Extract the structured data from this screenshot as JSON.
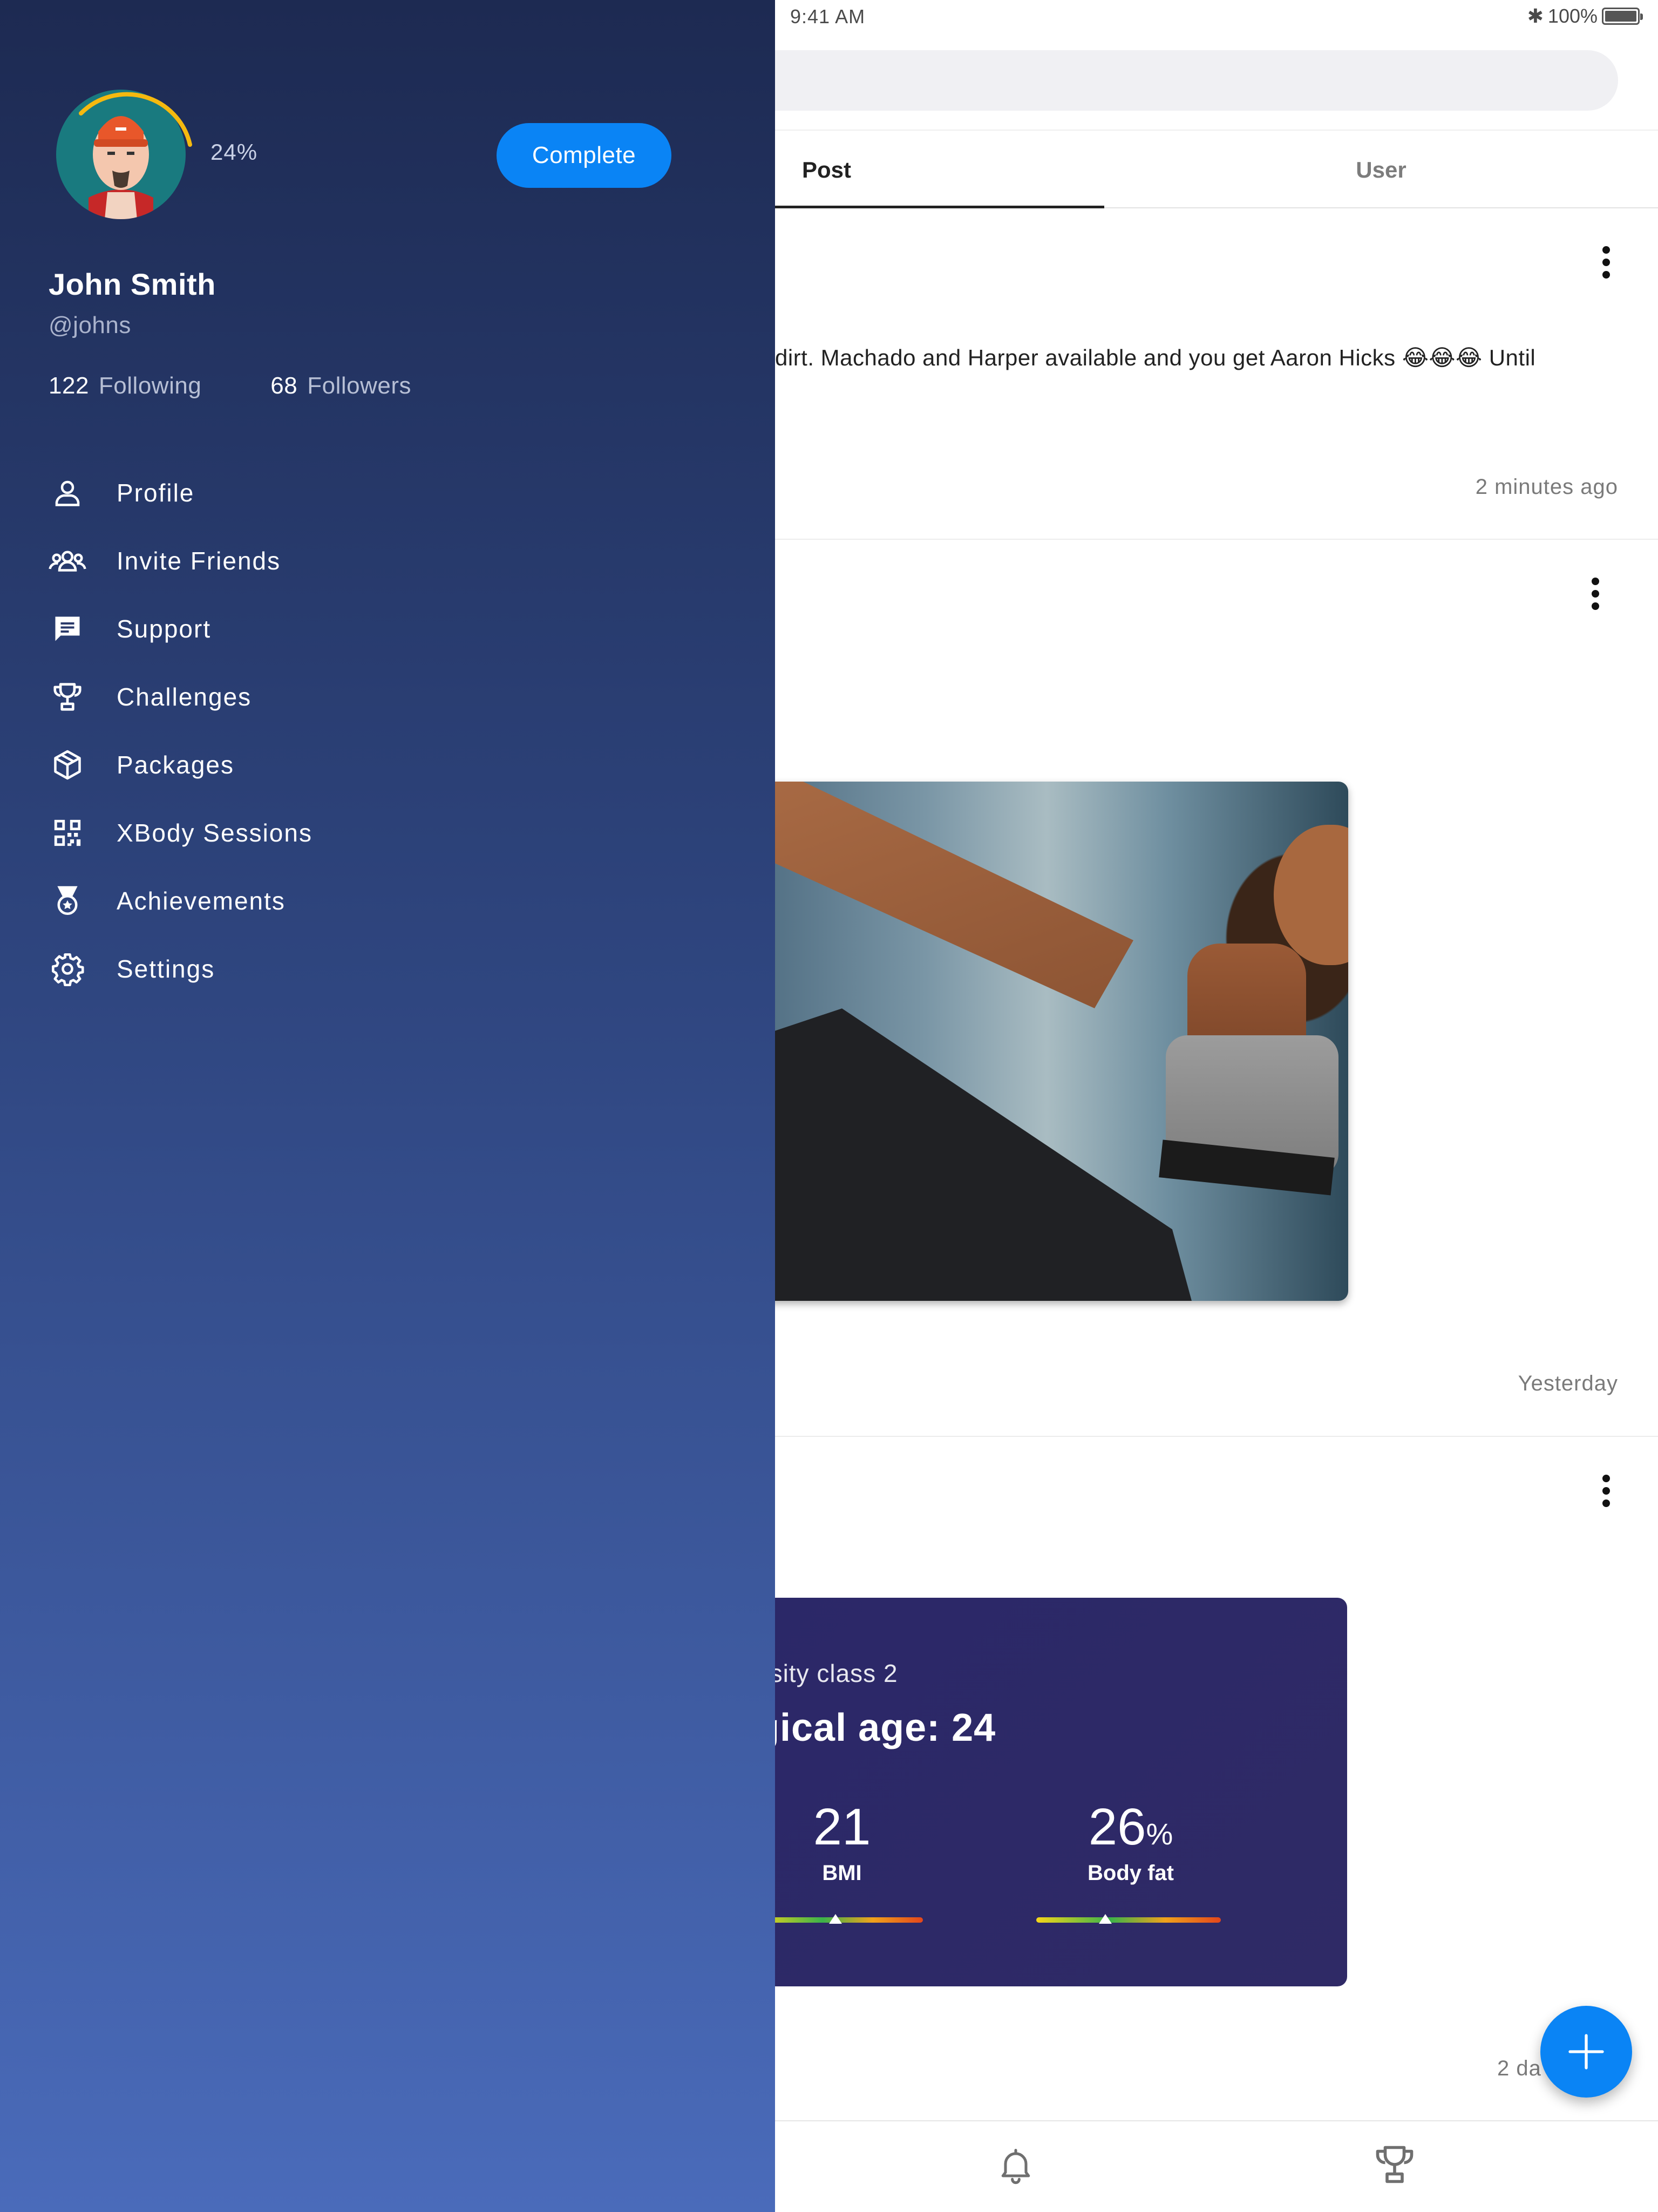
{
  "status_bar": {
    "time": "9:41 AM",
    "battery": "100%"
  },
  "tabs": [
    {
      "label": "Post"
    },
    {
      "label": "User"
    }
  ],
  "feed": {
    "post1": {
      "text": "dirt. Machado and Harper available and you get Aaron Hicks 😂😂😂 Until",
      "time": "2 minutes ago"
    },
    "post2": {
      "time": "Yesterday"
    },
    "post3": {
      "time": "2 da",
      "card": {
        "class_text": "esity class 2",
        "age_text": "gical age: 24",
        "bmi_value": "21",
        "bmi_label": "BMI",
        "body_fat_value": "26",
        "body_fat_unit": "%",
        "body_fat_label": "Body fat"
      }
    }
  },
  "drawer": {
    "profile_progress": "24%",
    "complete_label": "Complete",
    "name": "John Smith",
    "handle": "@johns",
    "following_count": "122",
    "following_label": "Following",
    "followers_count": "68",
    "followers_label": "Followers",
    "menu": [
      {
        "label": "Profile",
        "icon": "person-icon"
      },
      {
        "label": "Invite Friends",
        "icon": "group-icon"
      },
      {
        "label": "Support",
        "icon": "chat-icon"
      },
      {
        "label": "Challenges",
        "icon": "trophy-icon"
      },
      {
        "label": "Packages",
        "icon": "package-icon"
      },
      {
        "label": "XBody Sessions",
        "icon": "qr-code-icon"
      },
      {
        "label": "Achievements",
        "icon": "medal-icon"
      },
      {
        "label": "Settings",
        "icon": "gear-icon"
      }
    ]
  },
  "bottom_nav": {
    "icons": [
      "bell-icon",
      "trophy-icon"
    ]
  },
  "colors": {
    "accent": "#0a84f5",
    "drawer_top": "#1d2a52",
    "drawer_bottom": "#4a6bba",
    "stats_card": "#2d2967",
    "progress_ring": "#f5b90f"
  }
}
